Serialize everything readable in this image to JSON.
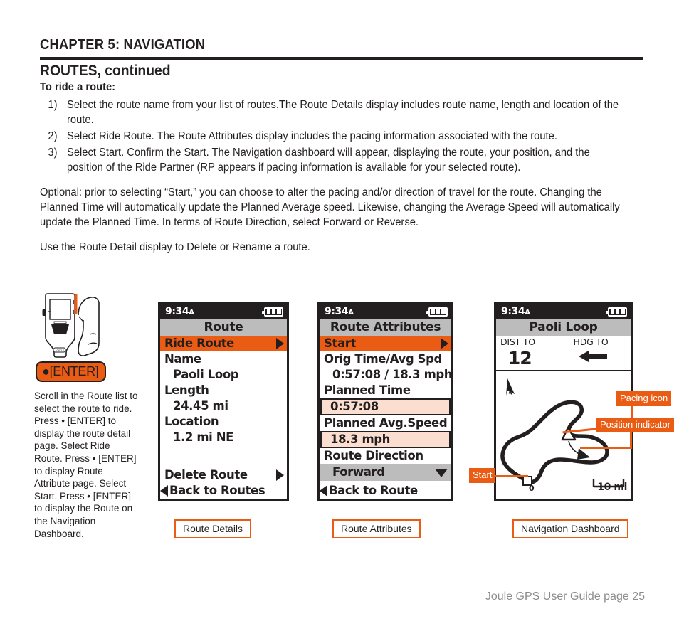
{
  "header": {
    "chapter": "CHAPTER 5: NAVIGATION",
    "section": "ROUTES, continued"
  },
  "body": {
    "lead_in": "To ride a route:",
    "steps": [
      {
        "num": "1)",
        "text": "Select the route name from your list of routes.The Route Details display includes route name, length and location of the route."
      },
      {
        "num": "2)",
        "text": "Select Ride Route. The Route Attributes display includes the pacing information associated with the route."
      },
      {
        "num": "3)",
        "text": "Select Start. Confirm the Start. The Navigation dashboard will appear, displaying the route, your position, and the position of the Ride Partner (RP appears if pacing information is available for your selected route)."
      }
    ],
    "paragraphs": [
      "Optional: prior to selecting “Start,” you can choose to alter the pacing and/or direction of travel for the route. Changing the Planned Time will automatically update the Planned Average speed. Likewise, changing the Average Speed will automatically update the Planned Time. In terms of Route Direction, select Forward or Reverse.",
      "Use the Route Detail display to Delete or Rename a route."
    ]
  },
  "sidebar": {
    "enter_button_label": "●[ENTER]",
    "caption": "Scroll in the Route list to select the route to ride. Press • [ENTER] to display the route detail page. Select Ride Route. Press • [ENTER] to display Route Attribute page. Select Start. Press • [ENTER] to display the Route on the Navigation Dashboard."
  },
  "screens": {
    "status": {
      "time": "9:34",
      "ampm": "A"
    },
    "route_details": {
      "title": "Route",
      "rows": [
        {
          "label": "Ride Route",
          "selected": true,
          "caret": "right"
        },
        {
          "label": "Name",
          "selected": false,
          "caret": "none"
        },
        {
          "label": "Paoli Loop",
          "selected": false,
          "caret": "none",
          "indent": true
        },
        {
          "label": "Length",
          "selected": false,
          "caret": "none"
        },
        {
          "label": "24.45 mi",
          "selected": false,
          "caret": "none",
          "indent": true
        },
        {
          "label": "Location",
          "selected": false,
          "caret": "none"
        },
        {
          "label": "1.2 mi NE",
          "selected": false,
          "caret": "none",
          "indent": true
        }
      ],
      "delete_label": "Delete Route",
      "back_label": "Back to Routes"
    },
    "route_attributes": {
      "title": "Route Attributes",
      "start_label": "Start",
      "orig_label": "Orig Time/Avg Spd",
      "orig_value": "0:57:08 / 18.3 mph",
      "planned_time_label": "Planned Time",
      "planned_time_value": "0:57:08",
      "planned_speed_label": "Planned Avg.Speed",
      "planned_speed_value": "18.3 mph",
      "direction_label": "Route Direction",
      "direction_value": "Forward",
      "back_label": "Back to Route"
    },
    "navigation_dashboard": {
      "title": "Paoli Loop",
      "dist_to_label": "DIST TO",
      "dist_to_value": "12",
      "hdg_to_label": "HDG TO",
      "hdg_to_icon": "arrow-left-icon",
      "north_icon": "north-arrow-icon",
      "start_marker_label": "0",
      "scale_label": "10 mi"
    }
  },
  "callouts": {
    "pacing": "Pacing icon",
    "position": "Position indicator",
    "start": "Start"
  },
  "captions": {
    "one": "Route Details",
    "two": "Route Attributes",
    "three": "Navigation Dashboard"
  },
  "footer": "Joule GPS User Guide page 25",
  "colors": {
    "accent_orange": "#ea5b13",
    "ink": "#231f20",
    "title_gray": "#bcbcbc",
    "field_peach": "#fbded0",
    "footer_gray": "#8c8c8c"
  }
}
